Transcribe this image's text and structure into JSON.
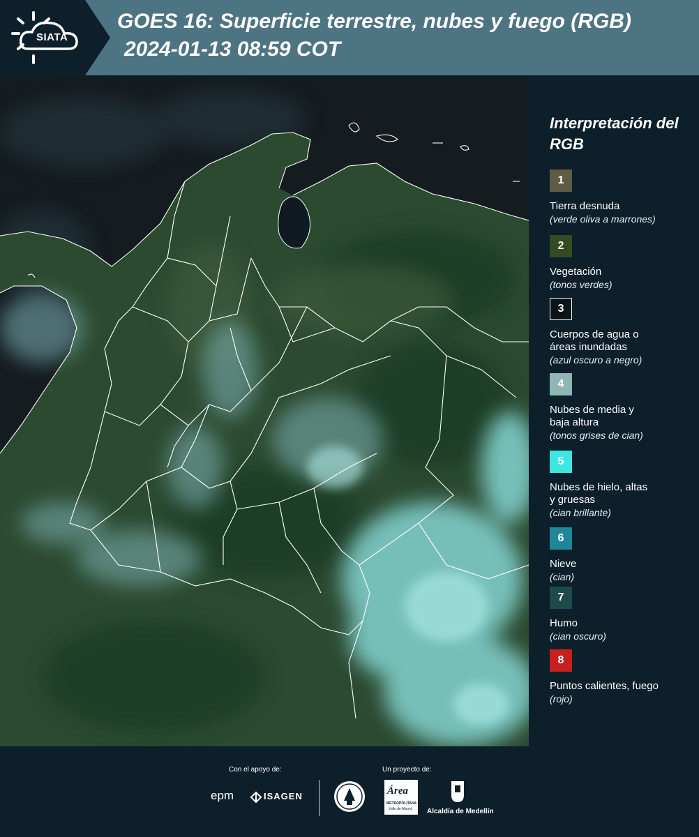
{
  "header": {
    "logo_text": "SIATA",
    "title_line1": "GOES 16: Superficie terrestre, nubes y fuego (RGB)",
    "title_line2": "2024-01-13 08:59 COT"
  },
  "legend": {
    "title": "Interpretación del RGB",
    "items": [
      {
        "number": "1",
        "label": "Tierra desnuda",
        "sub": "(verde oliva a marrones)",
        "color": "#5e5c44"
      },
      {
        "number": "2",
        "label": "Vegetación",
        "sub": "(tonos verdes)",
        "color": "#344a23"
      },
      {
        "number": "3",
        "label": "Cuerpos de agua o áreas inundadas",
        "sub": "(azul oscuro a negro)",
        "color": "#0b1418"
      },
      {
        "number": "4",
        "label": "Nubes de media y baja altura",
        "sub": "(tonos grises de cian)",
        "color": "#8fb5b4"
      },
      {
        "number": "5",
        "label": "Nubes de hielo, altas y gruesas",
        "sub": "(cian brillante)",
        "color": "#3ee6e2"
      },
      {
        "number": "6",
        "label": "Nieve",
        "sub": "(cian)",
        "color": "#1f8797"
      },
      {
        "number": "7",
        "label": "Humo",
        "sub": "(cian oscuro)",
        "color": "#1e4a4a"
      },
      {
        "number": "8",
        "label": "Puntos calientes, fuego",
        "sub": "(rojo)",
        "color": "#c8201f"
      }
    ]
  },
  "footer": {
    "support_caption": "Con el apoyo de:",
    "project_caption": "Un proyecto de:",
    "sponsor_epm": "epm",
    "sponsor_isagen": "ISAGEN",
    "sponsor_area": "Área",
    "sponsor_area_sub": "METROPOLITANA",
    "sponsor_area_sub2": "Valle de Aburrá",
    "sponsor_alcaldia": "Alcaldía de Medellín"
  }
}
